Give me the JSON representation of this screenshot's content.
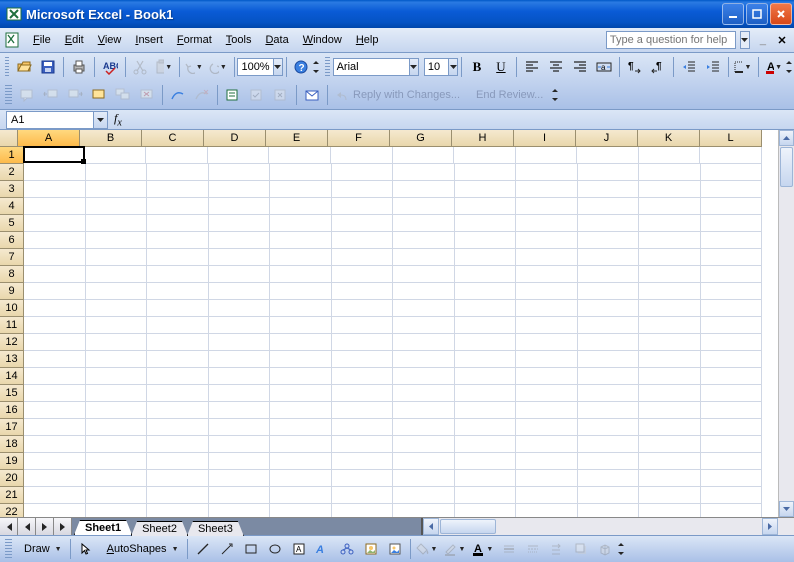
{
  "title": "Microsoft Excel - Book1",
  "menus": [
    "File",
    "Edit",
    "View",
    "Insert",
    "Format",
    "Tools",
    "Data",
    "Window",
    "Help"
  ],
  "help_placeholder": "Type a question for help",
  "toolbar1": {
    "zoom": "100%"
  },
  "toolbar2": {
    "font": "Arial",
    "size": "10"
  },
  "review": {
    "reply": "Reply with Changes...",
    "end": "End Review..."
  },
  "namebox": "A1",
  "columns": [
    "A",
    "B",
    "C",
    "D",
    "E",
    "F",
    "G",
    "H",
    "I",
    "J",
    "K",
    "L"
  ],
  "rows": [
    "1",
    "2",
    "3",
    "4",
    "5",
    "6",
    "7",
    "8",
    "9",
    "10",
    "11",
    "12",
    "13",
    "14",
    "15",
    "16",
    "17",
    "18",
    "19",
    "20",
    "21",
    "22"
  ],
  "active_cell": "A1",
  "sheets": [
    {
      "name": "Sheet1",
      "active": true
    },
    {
      "name": "Sheet2",
      "active": false
    },
    {
      "name": "Sheet3",
      "active": false
    }
  ],
  "drawbar": {
    "draw": "Draw",
    "autoshapes": "AutoShapes"
  }
}
